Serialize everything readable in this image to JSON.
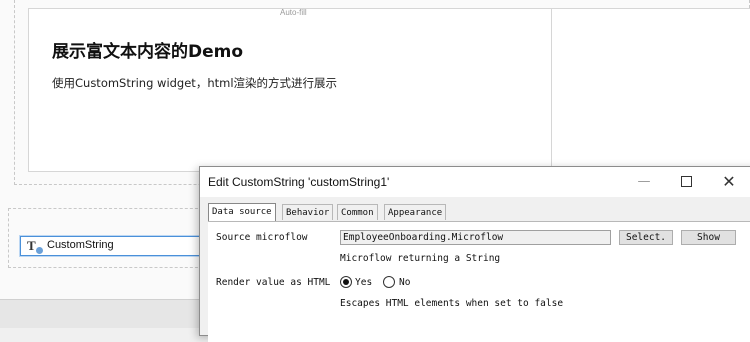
{
  "designer": {
    "autofill_label": "Auto-fill",
    "demo_title": "展示富文本内容的Demo",
    "demo_desc": "使用CustomString widget，html渲染的方式进行展示",
    "widget_label": "CustomString",
    "widget_icon": "custom-string-icon"
  },
  "dialog": {
    "title": "Edit CustomString 'customString1'",
    "buttons": {
      "minimize": "—",
      "maximize": "maximize-icon",
      "close": "✕"
    },
    "tabs": [
      {
        "label": "Data source",
        "active": true
      },
      {
        "label": "Behavior",
        "active": false
      },
      {
        "label": "Common",
        "active": false
      },
      {
        "label": "Appearance",
        "active": false
      }
    ],
    "source_microflow": {
      "label": "Source microflow",
      "value": "EmployeeOnboarding.Microflow",
      "select_label": "Select.",
      "show_label": "Show",
      "hint": "Microflow returning a String"
    },
    "render_html": {
      "label": "Render value as HTML",
      "yes_label": "Yes",
      "no_label": "No",
      "selected": "Yes",
      "hint": "Escapes HTML elements when set to false"
    }
  }
}
